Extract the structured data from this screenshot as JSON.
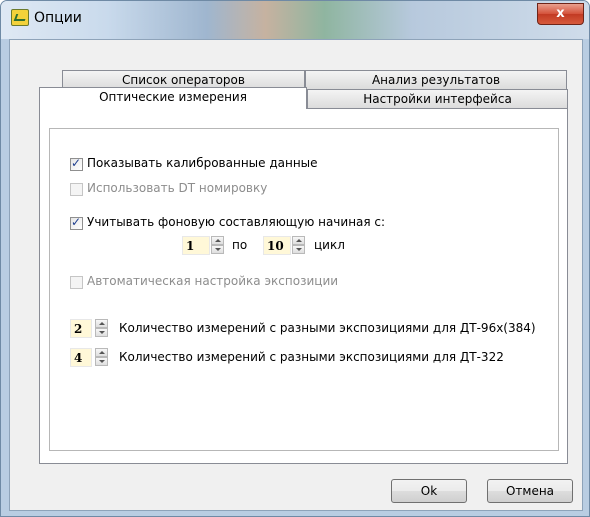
{
  "window": {
    "title": "Опции",
    "close_glyph": "x"
  },
  "tabs": {
    "row1": [
      "Список операторов",
      "Анализ результатов"
    ],
    "row2": [
      "Оптические измерения",
      "Настройки интерфейса"
    ],
    "active": "Оптические измерения"
  },
  "options": {
    "show_calibrated": {
      "label": "Показывать калиброванные данные",
      "checked": true,
      "enabled": true
    },
    "use_dt_numbering": {
      "label": "Использовать DT номировку",
      "checked": false,
      "enabled": false
    },
    "background_subtract": {
      "label": "Учитывать фоновую составляющую начиная с:",
      "checked": true,
      "enabled": true
    },
    "range": {
      "from": "1",
      "separator": "по",
      "to": "10",
      "unit": "цикл"
    },
    "auto_exposure": {
      "label": "Автоматическая настройка экспозиции",
      "checked": false,
      "enabled": false
    },
    "exposures_dt96": {
      "value": "2",
      "label": "Количество измерений с разными экспозициями для ДТ-96х(384)"
    },
    "exposures_dt322": {
      "value": "4",
      "label": "Количество измерений с разными экспозициями для ДТ-322"
    }
  },
  "buttons": {
    "ok": "Ok",
    "cancel": "Отмена"
  },
  "icons": {
    "app": "app-icon",
    "close": "close-icon",
    "spin_up": "arrow-up-icon",
    "spin_down": "arrow-down-icon"
  }
}
